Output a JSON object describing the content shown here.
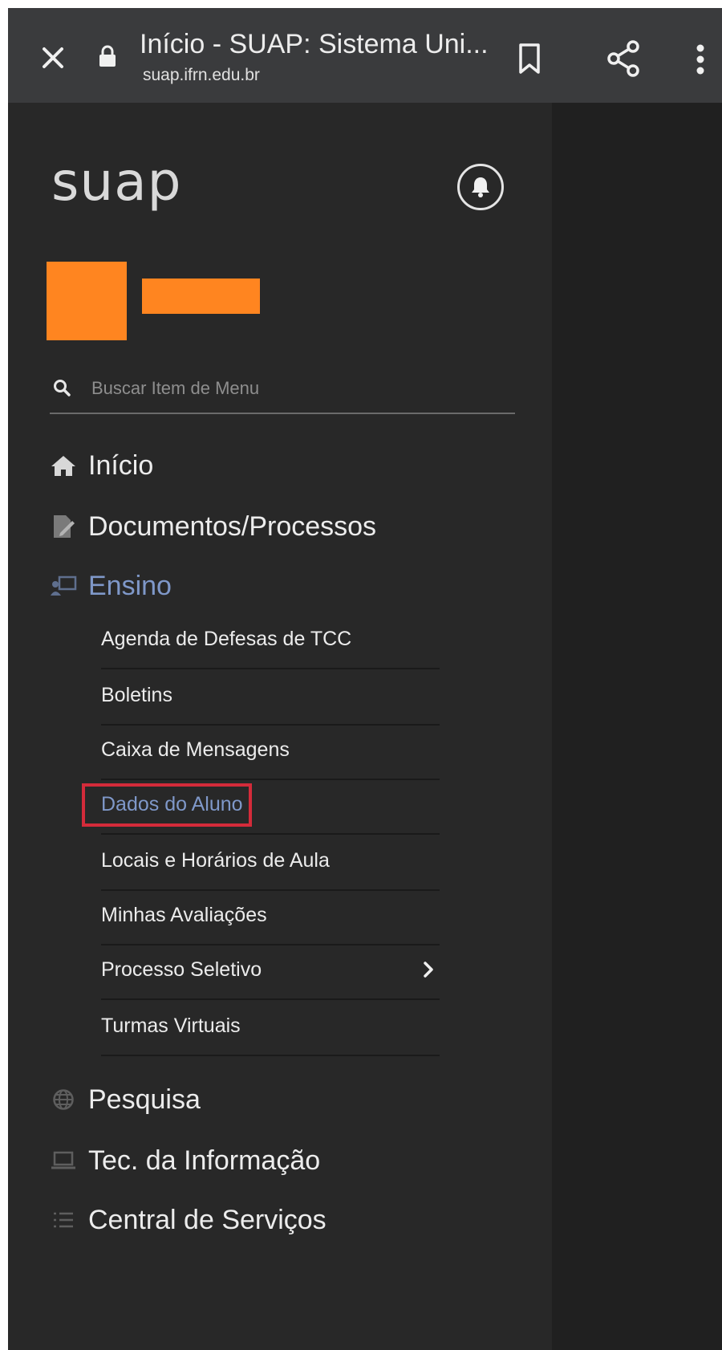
{
  "browser": {
    "title": "Início - SUAP: Sistema Uni...",
    "url": "suap.ifrn.edu.br",
    "icons": [
      "close-icon",
      "lock-icon",
      "bookmark-icon",
      "share-icon",
      "more-vert-icon"
    ]
  },
  "sidebar": {
    "logo": "suap",
    "search": {
      "placeholder": "Buscar Item de Menu",
      "value": ""
    },
    "menu": [
      {
        "label": "Início",
        "icon": "home-icon"
      },
      {
        "label": "Documentos/Processos",
        "icon": "document-edit-icon"
      },
      {
        "label": "Ensino",
        "icon": "teaching-icon",
        "active": true
      },
      {
        "label": "Pesquisa",
        "icon": "globe-icon"
      },
      {
        "label": "Tec. da Informação",
        "icon": "laptop-icon"
      },
      {
        "label": "Central de Serviços",
        "icon": "list-icon"
      }
    ],
    "ensino_items": [
      {
        "label": "Agenda de Defesas de TCC"
      },
      {
        "label": "Boletins"
      },
      {
        "label": "Caixa de Mensagens"
      },
      {
        "label": "Dados do Aluno",
        "selected": true
      },
      {
        "label": "Locais e Horários de Aula"
      },
      {
        "label": "Minhas Avaliações"
      },
      {
        "label": "Processo Seletivo",
        "has_submenu": true
      },
      {
        "label": "Turmas Virtuais"
      }
    ]
  },
  "colors": {
    "browser_bar": "#3a3b3d",
    "sidebar_bg": "#282828",
    "content_bg": "#202020",
    "active_text": "#7f98c9",
    "avatar": "#ff8520",
    "highlight": "#d42b3a"
  }
}
